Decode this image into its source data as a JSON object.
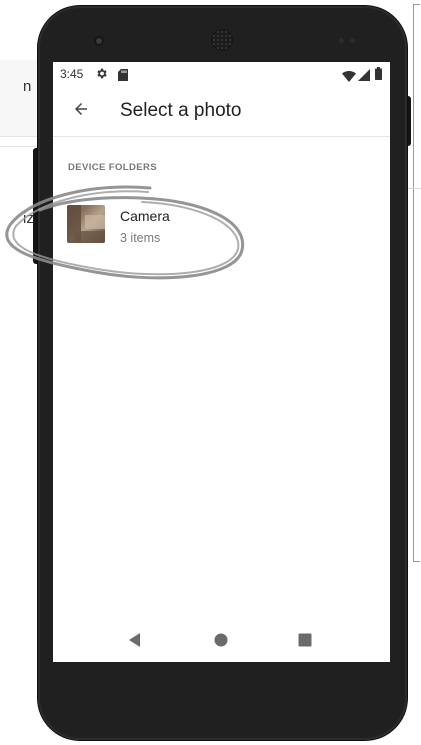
{
  "background": {
    "fragment_top": "n",
    "fragment_mid": "iz"
  },
  "status_bar": {
    "time": "3:45",
    "icons": [
      "gear-icon",
      "sd-card-icon",
      "wifi-icon",
      "signal-icon",
      "battery-icon"
    ]
  },
  "app_bar": {
    "back_icon": "arrow-back-icon",
    "title": "Select a photo"
  },
  "section": {
    "header": "DEVICE FOLDERS"
  },
  "folders": [
    {
      "name": "Camera",
      "count": "3 items"
    }
  ],
  "nav_bar": {
    "icons": [
      "triangle-back-icon",
      "circle-home-icon",
      "square-recents-icon"
    ]
  },
  "colors": {
    "phone_body": "#202020",
    "screen_bg": "#ffffff",
    "title_text": "#202124",
    "secondary_text": "#7a7a7a",
    "annotation_stroke": "#8a8a8a"
  }
}
